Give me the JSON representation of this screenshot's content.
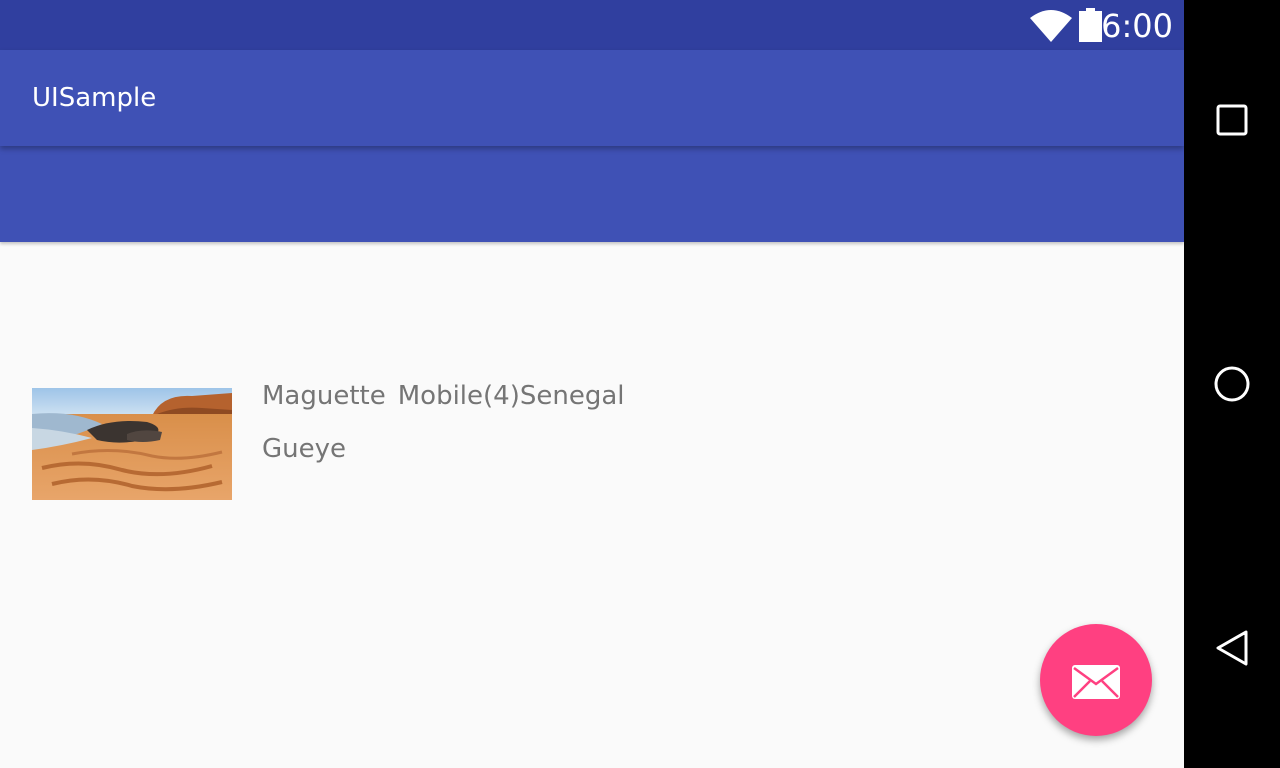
{
  "status_bar": {
    "time": "6:00",
    "icons": [
      "wifi-icon",
      "battery-icon"
    ],
    "background": "#303f9f"
  },
  "app_bar": {
    "title": "UISample",
    "background": "#3f51b5"
  },
  "list": {
    "items": [
      {
        "image": "beach-image",
        "first_name": "Maguette",
        "phone": "Mobile(4)Senegal",
        "last_name": "Gueye"
      }
    ]
  },
  "fab": {
    "icon": "email-icon",
    "color": "#ff4081"
  },
  "nav_bar": {
    "buttons": [
      "recents-icon",
      "home-icon",
      "back-icon"
    ]
  }
}
